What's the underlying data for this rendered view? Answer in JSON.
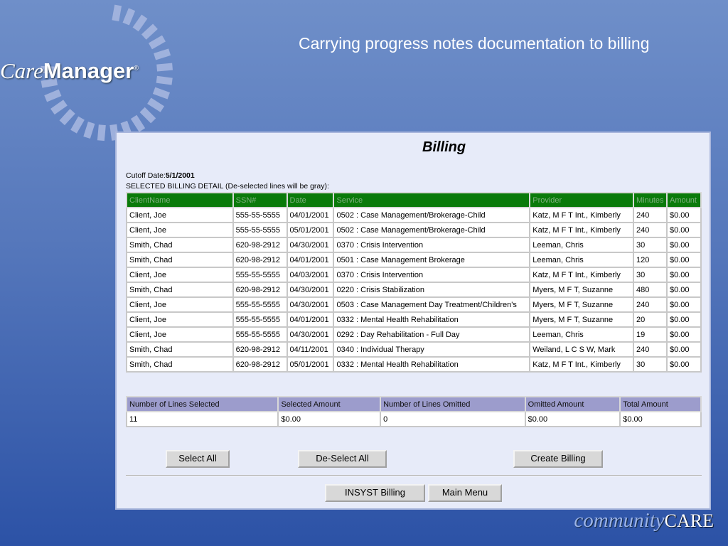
{
  "slide_title": "Carrying progress notes documentation to billing",
  "logo": {
    "care": "Care",
    "manager": "Manager",
    "reg": "®"
  },
  "footer_logo": {
    "community": "community",
    "care": "CARE"
  },
  "page": {
    "title": "Billing",
    "cutoff_label": "Cutoff Date:",
    "cutoff_value": "5/1/2001",
    "detail_label": "SELECTED BILLING DETAIL (De-selected lines will be gray):"
  },
  "detail": {
    "headers": [
      "ClientName",
      "SSN#",
      "Date",
      "Service",
      "Provider",
      "Minutes",
      "Amount"
    ],
    "rows": [
      [
        "Client, Joe",
        "555-55-5555",
        "04/01/2001",
        "0502 : Case Management/Brokerage-Child",
        "Katz, M F T Int., Kimberly",
        "240",
        "$0.00"
      ],
      [
        "Client, Joe",
        "555-55-5555",
        "05/01/2001",
        "0502 : Case Management/Brokerage-Child",
        "Katz, M F T Int., Kimberly",
        "240",
        "$0.00"
      ],
      [
        "Smith, Chad",
        "620-98-2912",
        "04/30/2001",
        "0370 : Crisis Intervention",
        "Leeman, Chris",
        "30",
        "$0.00"
      ],
      [
        "Smith, Chad",
        "620-98-2912",
        "04/01/2001",
        "0501 : Case Management Brokerage",
        "Leeman, Chris",
        "120",
        "$0.00"
      ],
      [
        "Client, Joe",
        "555-55-5555",
        "04/03/2001",
        "0370 : Crisis Intervention",
        "Katz, M F T Int., Kimberly",
        "30",
        "$0.00"
      ],
      [
        "Smith, Chad",
        "620-98-2912",
        "04/30/2001",
        "0220 : Crisis Stabilization",
        "Myers, M F T, Suzanne",
        "480",
        "$0.00"
      ],
      [
        "Client, Joe",
        "555-55-5555",
        "04/30/2001",
        "0503 : Case Management Day Treatment/Children's",
        "Myers, M F T, Suzanne",
        "240",
        "$0.00"
      ],
      [
        "Client, Joe",
        "555-55-5555",
        "04/01/2001",
        "0332 : Mental Health Rehabilitation",
        "Myers, M F T, Suzanne",
        "20",
        "$0.00"
      ],
      [
        "Client, Joe",
        "555-55-5555",
        "04/30/2001",
        "0292 : Day Rehabilitation - Full Day",
        "Leeman, Chris",
        "19",
        "$0.00"
      ],
      [
        "Smith, Chad",
        "620-98-2912",
        "04/11/2001",
        "0340 : Individual Therapy",
        "Weiland, L C S W, Mark",
        "240",
        "$0.00"
      ],
      [
        "Smith, Chad",
        "620-98-2912",
        "05/01/2001",
        "0332 : Mental Health Rehabilitation",
        "Katz, M F T Int., Kimberly",
        "30",
        "$0.00"
      ]
    ]
  },
  "summary": {
    "headers": [
      "Number of Lines Selected",
      "Selected Amount",
      "Number of Lines Omitted",
      "Omitted Amount",
      "Total Amount"
    ],
    "values": [
      "11",
      "$0.00",
      "0",
      "$0.00",
      "$0.00"
    ]
  },
  "buttons": {
    "select_all": "Select All",
    "deselect_all": "De-Select All",
    "create_billing": "Create Billing",
    "insyst_billing": "INSYST Billing",
    "main_menu": "Main Menu"
  }
}
